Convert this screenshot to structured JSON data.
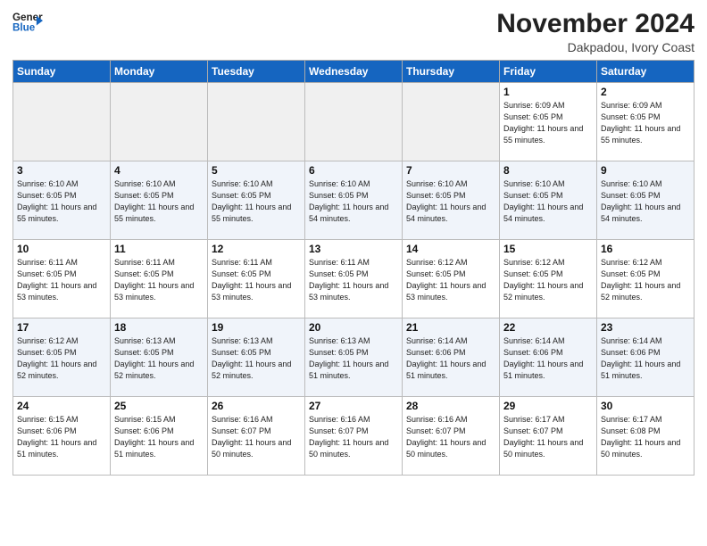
{
  "header": {
    "logo_line1": "General",
    "logo_line2": "Blue",
    "month_title": "November 2024",
    "location": "Dakpadou, Ivory Coast"
  },
  "weekdays": [
    "Sunday",
    "Monday",
    "Tuesday",
    "Wednesday",
    "Thursday",
    "Friday",
    "Saturday"
  ],
  "weeks": [
    [
      {
        "day": "",
        "empty": true
      },
      {
        "day": "",
        "empty": true
      },
      {
        "day": "",
        "empty": true
      },
      {
        "day": "",
        "empty": true
      },
      {
        "day": "",
        "empty": true
      },
      {
        "day": "1",
        "sunrise": "Sunrise: 6:09 AM",
        "sunset": "Sunset: 6:05 PM",
        "daylight": "Daylight: 11 hours and 55 minutes."
      },
      {
        "day": "2",
        "sunrise": "Sunrise: 6:09 AM",
        "sunset": "Sunset: 6:05 PM",
        "daylight": "Daylight: 11 hours and 55 minutes."
      }
    ],
    [
      {
        "day": "3",
        "sunrise": "Sunrise: 6:10 AM",
        "sunset": "Sunset: 6:05 PM",
        "daylight": "Daylight: 11 hours and 55 minutes."
      },
      {
        "day": "4",
        "sunrise": "Sunrise: 6:10 AM",
        "sunset": "Sunset: 6:05 PM",
        "daylight": "Daylight: 11 hours and 55 minutes."
      },
      {
        "day": "5",
        "sunrise": "Sunrise: 6:10 AM",
        "sunset": "Sunset: 6:05 PM",
        "daylight": "Daylight: 11 hours and 55 minutes."
      },
      {
        "day": "6",
        "sunrise": "Sunrise: 6:10 AM",
        "sunset": "Sunset: 6:05 PM",
        "daylight": "Daylight: 11 hours and 54 minutes."
      },
      {
        "day": "7",
        "sunrise": "Sunrise: 6:10 AM",
        "sunset": "Sunset: 6:05 PM",
        "daylight": "Daylight: 11 hours and 54 minutes."
      },
      {
        "day": "8",
        "sunrise": "Sunrise: 6:10 AM",
        "sunset": "Sunset: 6:05 PM",
        "daylight": "Daylight: 11 hours and 54 minutes."
      },
      {
        "day": "9",
        "sunrise": "Sunrise: 6:10 AM",
        "sunset": "Sunset: 6:05 PM",
        "daylight": "Daylight: 11 hours and 54 minutes."
      }
    ],
    [
      {
        "day": "10",
        "sunrise": "Sunrise: 6:11 AM",
        "sunset": "Sunset: 6:05 PM",
        "daylight": "Daylight: 11 hours and 53 minutes."
      },
      {
        "day": "11",
        "sunrise": "Sunrise: 6:11 AM",
        "sunset": "Sunset: 6:05 PM",
        "daylight": "Daylight: 11 hours and 53 minutes."
      },
      {
        "day": "12",
        "sunrise": "Sunrise: 6:11 AM",
        "sunset": "Sunset: 6:05 PM",
        "daylight": "Daylight: 11 hours and 53 minutes."
      },
      {
        "day": "13",
        "sunrise": "Sunrise: 6:11 AM",
        "sunset": "Sunset: 6:05 PM",
        "daylight": "Daylight: 11 hours and 53 minutes."
      },
      {
        "day": "14",
        "sunrise": "Sunrise: 6:12 AM",
        "sunset": "Sunset: 6:05 PM",
        "daylight": "Daylight: 11 hours and 53 minutes."
      },
      {
        "day": "15",
        "sunrise": "Sunrise: 6:12 AM",
        "sunset": "Sunset: 6:05 PM",
        "daylight": "Daylight: 11 hours and 52 minutes."
      },
      {
        "day": "16",
        "sunrise": "Sunrise: 6:12 AM",
        "sunset": "Sunset: 6:05 PM",
        "daylight": "Daylight: 11 hours and 52 minutes."
      }
    ],
    [
      {
        "day": "17",
        "sunrise": "Sunrise: 6:12 AM",
        "sunset": "Sunset: 6:05 PM",
        "daylight": "Daylight: 11 hours and 52 minutes."
      },
      {
        "day": "18",
        "sunrise": "Sunrise: 6:13 AM",
        "sunset": "Sunset: 6:05 PM",
        "daylight": "Daylight: 11 hours and 52 minutes."
      },
      {
        "day": "19",
        "sunrise": "Sunrise: 6:13 AM",
        "sunset": "Sunset: 6:05 PM",
        "daylight": "Daylight: 11 hours and 52 minutes."
      },
      {
        "day": "20",
        "sunrise": "Sunrise: 6:13 AM",
        "sunset": "Sunset: 6:05 PM",
        "daylight": "Daylight: 11 hours and 51 minutes."
      },
      {
        "day": "21",
        "sunrise": "Sunrise: 6:14 AM",
        "sunset": "Sunset: 6:06 PM",
        "daylight": "Daylight: 11 hours and 51 minutes."
      },
      {
        "day": "22",
        "sunrise": "Sunrise: 6:14 AM",
        "sunset": "Sunset: 6:06 PM",
        "daylight": "Daylight: 11 hours and 51 minutes."
      },
      {
        "day": "23",
        "sunrise": "Sunrise: 6:14 AM",
        "sunset": "Sunset: 6:06 PM",
        "daylight": "Daylight: 11 hours and 51 minutes."
      }
    ],
    [
      {
        "day": "24",
        "sunrise": "Sunrise: 6:15 AM",
        "sunset": "Sunset: 6:06 PM",
        "daylight": "Daylight: 11 hours and 51 minutes."
      },
      {
        "day": "25",
        "sunrise": "Sunrise: 6:15 AM",
        "sunset": "Sunset: 6:06 PM",
        "daylight": "Daylight: 11 hours and 51 minutes."
      },
      {
        "day": "26",
        "sunrise": "Sunrise: 6:16 AM",
        "sunset": "Sunset: 6:07 PM",
        "daylight": "Daylight: 11 hours and 50 minutes."
      },
      {
        "day": "27",
        "sunrise": "Sunrise: 6:16 AM",
        "sunset": "Sunset: 6:07 PM",
        "daylight": "Daylight: 11 hours and 50 minutes."
      },
      {
        "day": "28",
        "sunrise": "Sunrise: 6:16 AM",
        "sunset": "Sunset: 6:07 PM",
        "daylight": "Daylight: 11 hours and 50 minutes."
      },
      {
        "day": "29",
        "sunrise": "Sunrise: 6:17 AM",
        "sunset": "Sunset: 6:07 PM",
        "daylight": "Daylight: 11 hours and 50 minutes."
      },
      {
        "day": "30",
        "sunrise": "Sunrise: 6:17 AM",
        "sunset": "Sunset: 6:08 PM",
        "daylight": "Daylight: 11 hours and 50 minutes."
      }
    ]
  ]
}
